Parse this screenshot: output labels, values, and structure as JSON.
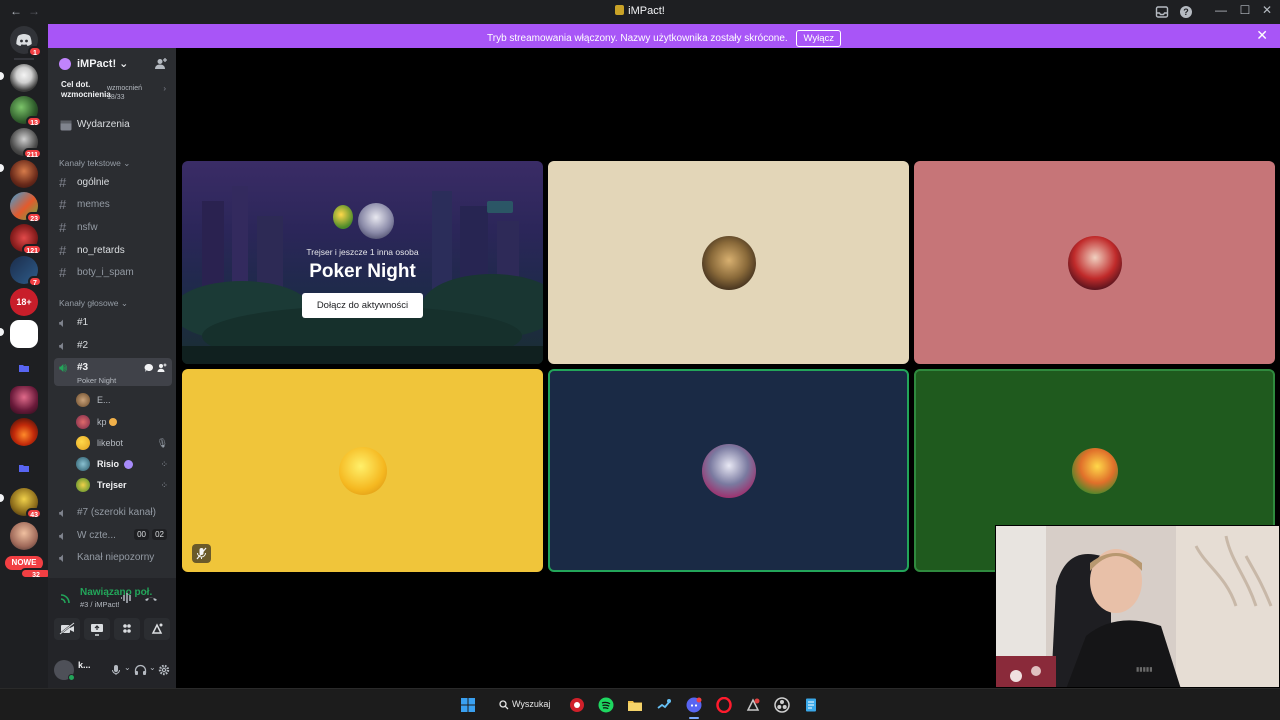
{
  "window": {
    "title": "iMPact!",
    "back_glyph": "←",
    "forward_glyph": "→",
    "minimize_glyph": "—",
    "maximize_glyph": "☐",
    "close_glyph": "✕"
  },
  "banner": {
    "text": "Tryb streamowania włączony. Nazwy użytkownika zostały skrócone.",
    "button": "Wyłącz",
    "close_glyph": "✕",
    "color": "#a855f7"
  },
  "rail": {
    "badges": [
      "1",
      "13",
      "211",
      "23",
      "121",
      "7",
      "43",
      "32"
    ],
    "new_label": "NOWE",
    "eighteen_label": "18+"
  },
  "server": {
    "name": "iMPact!",
    "boost_label": "Cel dot. wzmocnienia",
    "boost_side": "wzmocnień",
    "boost_progress": "18/33",
    "events": "Wydarzenia"
  },
  "categories": {
    "text": "Kanały tekstowe",
    "voice": "Kanały głosowe"
  },
  "text_channels": [
    "ogólnie",
    "memes",
    "nsfw",
    "no_retards",
    "boty_i_spam"
  ],
  "voice_channels": {
    "c1": "#1",
    "c2": "#2",
    "c3": "#3",
    "c3_activity": "Poker Night",
    "c7": "#7 (szeroki kanał)",
    "c8": "W czte...",
    "c8_count_a": "00",
    "c8_count_b": "02",
    "c9": "Kanał niepozorny"
  },
  "voice_users": [
    {
      "name": "E..."
    },
    {
      "name": "kp"
    },
    {
      "name": "likebot"
    },
    {
      "name": "Risio"
    },
    {
      "name": "Trejser"
    }
  ],
  "voice_status": {
    "connected": "Nawiązano poł...",
    "location": "#3 / iMPact!"
  },
  "current_user": {
    "name": "k..."
  },
  "activity": {
    "subtitle": "Trejser i jeszcze 1 inna osoba",
    "title": "Poker Night",
    "join_button": "Dołącz do aktywności"
  },
  "tiles": {
    "colors": [
      "#e3d6b8",
      "#c67578",
      "#f0c53a",
      "#1a2a45",
      "#1f5a1e"
    ]
  },
  "taskbar": {
    "search_label": "Wyszukaj"
  },
  "colors": {
    "accent": "#a855f7",
    "connected": "#23a55a",
    "danger": "#f23f43"
  }
}
